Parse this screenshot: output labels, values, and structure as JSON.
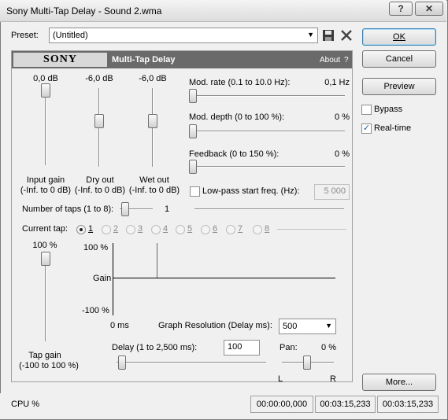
{
  "window": {
    "title": "Sony Multi-Tap Delay - Sound 2.wma",
    "help_button": "?",
    "close_button": "✕"
  },
  "preset": {
    "label": "Preset:",
    "value": "(Untitled)"
  },
  "buttons": {
    "ok": "OK",
    "cancel": "Cancel",
    "preview": "Preview",
    "more": "More..."
  },
  "checkboxes": {
    "bypass": {
      "label": "Bypass",
      "checked": false
    },
    "realtime": {
      "label": "Real-time",
      "checked": true
    }
  },
  "header": {
    "brand": "SONY",
    "plugin_name": "Multi-Tap Delay",
    "about": "About",
    "help": "?"
  },
  "faders": {
    "input": {
      "value": "0,0 dB",
      "label": "Input gain",
      "range": "(-Inf. to 0 dB)"
    },
    "dry": {
      "value": "-6,0 dB",
      "label": "Dry out",
      "range": "(-Inf. to 0 dB)"
    },
    "wet": {
      "value": "-6,0 dB",
      "label": "Wet out",
      "range": "(-Inf. to 0 dB)"
    }
  },
  "params": {
    "mod_rate": {
      "label": "Mod. rate (0.1 to 10.0 Hz):",
      "value": "0,1 Hz"
    },
    "mod_depth": {
      "label": "Mod. depth (0 to 100 %):",
      "value": "0 %"
    },
    "feedback": {
      "label": "Feedback (0 to 150 %):",
      "value": "0 %"
    },
    "lowpass": {
      "label": "Low-pass start freq. (Hz):",
      "value": "5 000",
      "checked": false
    }
  },
  "taps": {
    "count_label": "Number of taps (1 to 8):",
    "count_value": "1",
    "current_label": "Current tap:",
    "options": [
      "1",
      "2",
      "3",
      "4",
      "5",
      "6",
      "7",
      "8"
    ],
    "selected": "1"
  },
  "tap_gain": {
    "value": "100 %",
    "label": "Tap gain",
    "range": "(-100 to 100 %)"
  },
  "graph": {
    "y_top": "100 %",
    "y_mid": "Gain",
    "y_bottom": "-100 %",
    "x_start": "0 ms"
  },
  "resolution": {
    "label": "Graph Resolution (Delay ms):",
    "value": "500"
  },
  "delay": {
    "label": "Delay (1 to 2,500 ms):",
    "value": "100"
  },
  "pan": {
    "label": "Pan:",
    "value": "0 %",
    "left": "L",
    "right": "R"
  },
  "status": {
    "cpu": "CPU %",
    "time1": "00:00:00,000",
    "time2": "00:03:15,233",
    "time3": "00:03:15,233"
  }
}
